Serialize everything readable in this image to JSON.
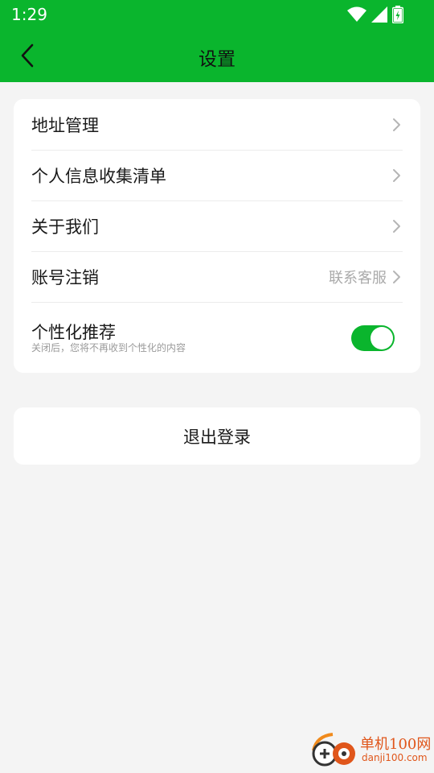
{
  "status_bar": {
    "time": "1:29",
    "icons": [
      "wifi-icon",
      "signal-icon",
      "battery-charging-icon"
    ]
  },
  "header": {
    "title": "设置",
    "back_icon": "chevron-left-icon",
    "color": "#0ab52d"
  },
  "settings": {
    "items": [
      {
        "label": "地址管理",
        "hint": ""
      },
      {
        "label": "个人信息收集清单",
        "hint": ""
      },
      {
        "label": "关于我们",
        "hint": ""
      },
      {
        "label": "账号注销",
        "hint": "联系客服"
      }
    ],
    "personalized": {
      "label": "个性化推荐",
      "sub": "关闭后，您将不再收到个性化的内容",
      "enabled": true
    }
  },
  "logout": {
    "label": "退出登录"
  },
  "watermark": {
    "name": "单机100网",
    "url": "danji100.com"
  }
}
